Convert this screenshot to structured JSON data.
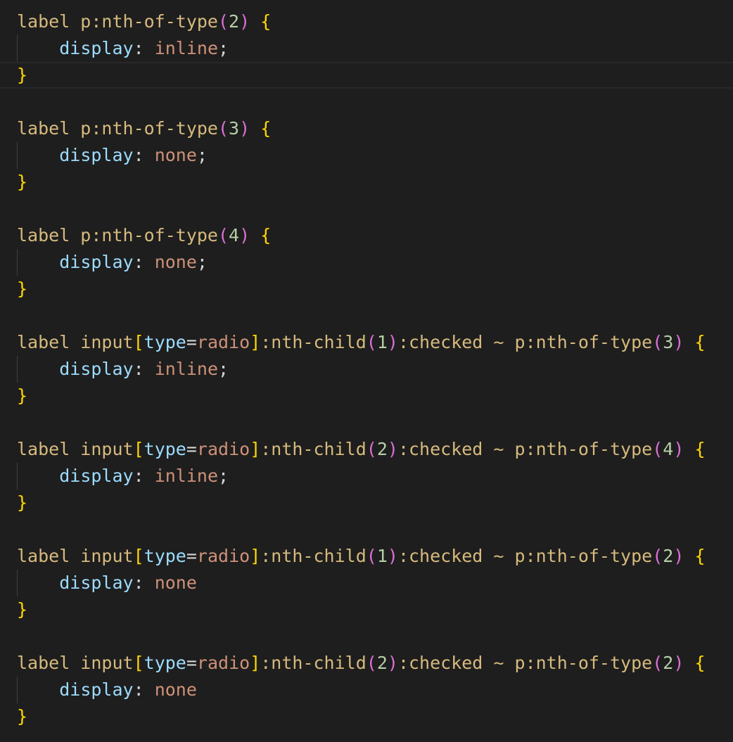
{
  "editor": {
    "language": "css",
    "theme": {
      "background": "#1e1e1e",
      "selector": "#d7ba7d",
      "brace": "#ffd700",
      "bracket": "#da70d6",
      "property": "#9cdcfe",
      "value": "#ce9178",
      "number": "#b5cea8",
      "punctuation": "#d4d4d4"
    },
    "current_line": 3,
    "lines": [
      [
        {
          "t": "label p:nth-of-type",
          "c": "t-sel"
        },
        {
          "t": "(",
          "c": "t-brk"
        },
        {
          "t": "2",
          "c": "t-num"
        },
        {
          "t": ")",
          "c": "t-brk"
        },
        {
          "t": " ",
          "c": "t-punct"
        },
        {
          "t": "{",
          "c": "t-brace"
        }
      ],
      [
        {
          "t": "    ",
          "c": "t-punct"
        },
        {
          "t": "display",
          "c": "t-prop"
        },
        {
          "t": ": ",
          "c": "t-punct"
        },
        {
          "t": "inline",
          "c": "t-val"
        },
        {
          "t": ";",
          "c": "t-punct"
        }
      ],
      [
        {
          "t": "}",
          "c": "t-brace"
        }
      ],
      [],
      [
        {
          "t": "label p:nth-of-type",
          "c": "t-sel"
        },
        {
          "t": "(",
          "c": "t-brk"
        },
        {
          "t": "3",
          "c": "t-num"
        },
        {
          "t": ")",
          "c": "t-brk"
        },
        {
          "t": " ",
          "c": "t-punct"
        },
        {
          "t": "{",
          "c": "t-brace"
        }
      ],
      [
        {
          "t": "    ",
          "c": "t-punct"
        },
        {
          "t": "display",
          "c": "t-prop"
        },
        {
          "t": ": ",
          "c": "t-punct"
        },
        {
          "t": "none",
          "c": "t-val"
        },
        {
          "t": ";",
          "c": "t-punct"
        }
      ],
      [
        {
          "t": "}",
          "c": "t-brace"
        }
      ],
      [],
      [
        {
          "t": "label p:nth-of-type",
          "c": "t-sel"
        },
        {
          "t": "(",
          "c": "t-brk"
        },
        {
          "t": "4",
          "c": "t-num"
        },
        {
          "t": ")",
          "c": "t-brk"
        },
        {
          "t": " ",
          "c": "t-punct"
        },
        {
          "t": "{",
          "c": "t-brace"
        }
      ],
      [
        {
          "t": "    ",
          "c": "t-punct"
        },
        {
          "t": "display",
          "c": "t-prop"
        },
        {
          "t": ": ",
          "c": "t-punct"
        },
        {
          "t": "none",
          "c": "t-val"
        },
        {
          "t": ";",
          "c": "t-punct"
        }
      ],
      [
        {
          "t": "}",
          "c": "t-brace"
        }
      ],
      [],
      [
        {
          "t": "label input",
          "c": "t-sel"
        },
        {
          "t": "[",
          "c": "t-brace"
        },
        {
          "t": "type",
          "c": "t-prop"
        },
        {
          "t": "=",
          "c": "t-punct"
        },
        {
          "t": "radio",
          "c": "t-val"
        },
        {
          "t": "]",
          "c": "t-brace"
        },
        {
          "t": ":nth-child",
          "c": "t-sel"
        },
        {
          "t": "(",
          "c": "t-brk"
        },
        {
          "t": "1",
          "c": "t-num"
        },
        {
          "t": ")",
          "c": "t-brk"
        },
        {
          "t": ":checked ~ p:nth-of-type",
          "c": "t-sel"
        },
        {
          "t": "(",
          "c": "t-brk"
        },
        {
          "t": "3",
          "c": "t-num"
        },
        {
          "t": ")",
          "c": "t-brk"
        },
        {
          "t": " ",
          "c": "t-punct"
        },
        {
          "t": "{",
          "c": "t-brace"
        }
      ],
      [
        {
          "t": "    ",
          "c": "t-punct"
        },
        {
          "t": "display",
          "c": "t-prop"
        },
        {
          "t": ": ",
          "c": "t-punct"
        },
        {
          "t": "inline",
          "c": "t-val"
        },
        {
          "t": ";",
          "c": "t-punct"
        }
      ],
      [
        {
          "t": "}",
          "c": "t-brace"
        }
      ],
      [],
      [
        {
          "t": "label input",
          "c": "t-sel"
        },
        {
          "t": "[",
          "c": "t-brace"
        },
        {
          "t": "type",
          "c": "t-prop"
        },
        {
          "t": "=",
          "c": "t-punct"
        },
        {
          "t": "radio",
          "c": "t-val"
        },
        {
          "t": "]",
          "c": "t-brace"
        },
        {
          "t": ":nth-child",
          "c": "t-sel"
        },
        {
          "t": "(",
          "c": "t-brk"
        },
        {
          "t": "2",
          "c": "t-num"
        },
        {
          "t": ")",
          "c": "t-brk"
        },
        {
          "t": ":checked ~ p:nth-of-type",
          "c": "t-sel"
        },
        {
          "t": "(",
          "c": "t-brk"
        },
        {
          "t": "4",
          "c": "t-num"
        },
        {
          "t": ")",
          "c": "t-brk"
        },
        {
          "t": " ",
          "c": "t-punct"
        },
        {
          "t": "{",
          "c": "t-brace"
        }
      ],
      [
        {
          "t": "    ",
          "c": "t-punct"
        },
        {
          "t": "display",
          "c": "t-prop"
        },
        {
          "t": ": ",
          "c": "t-punct"
        },
        {
          "t": "inline",
          "c": "t-val"
        },
        {
          "t": ";",
          "c": "t-punct"
        }
      ],
      [
        {
          "t": "}",
          "c": "t-brace"
        }
      ],
      [],
      [
        {
          "t": "label input",
          "c": "t-sel"
        },
        {
          "t": "[",
          "c": "t-brace"
        },
        {
          "t": "type",
          "c": "t-prop"
        },
        {
          "t": "=",
          "c": "t-punct"
        },
        {
          "t": "radio",
          "c": "t-val"
        },
        {
          "t": "]",
          "c": "t-brace"
        },
        {
          "t": ":nth-child",
          "c": "t-sel"
        },
        {
          "t": "(",
          "c": "t-brk"
        },
        {
          "t": "1",
          "c": "t-num"
        },
        {
          "t": ")",
          "c": "t-brk"
        },
        {
          "t": ":checked ~ p:nth-of-type",
          "c": "t-sel"
        },
        {
          "t": "(",
          "c": "t-brk"
        },
        {
          "t": "2",
          "c": "t-num"
        },
        {
          "t": ")",
          "c": "t-brk"
        },
        {
          "t": " ",
          "c": "t-punct"
        },
        {
          "t": "{",
          "c": "t-brace"
        }
      ],
      [
        {
          "t": "    ",
          "c": "t-punct"
        },
        {
          "t": "display",
          "c": "t-prop"
        },
        {
          "t": ": ",
          "c": "t-punct"
        },
        {
          "t": "none",
          "c": "t-val"
        }
      ],
      [
        {
          "t": "}",
          "c": "t-brace"
        }
      ],
      [],
      [
        {
          "t": "label input",
          "c": "t-sel"
        },
        {
          "t": "[",
          "c": "t-brace"
        },
        {
          "t": "type",
          "c": "t-prop"
        },
        {
          "t": "=",
          "c": "t-punct"
        },
        {
          "t": "radio",
          "c": "t-val"
        },
        {
          "t": "]",
          "c": "t-brace"
        },
        {
          "t": ":nth-child",
          "c": "t-sel"
        },
        {
          "t": "(",
          "c": "t-brk"
        },
        {
          "t": "2",
          "c": "t-num"
        },
        {
          "t": ")",
          "c": "t-brk"
        },
        {
          "t": ":checked ~ p:nth-of-type",
          "c": "t-sel"
        },
        {
          "t": "(",
          "c": "t-brk"
        },
        {
          "t": "2",
          "c": "t-num"
        },
        {
          "t": ")",
          "c": "t-brk"
        },
        {
          "t": " ",
          "c": "t-punct"
        },
        {
          "t": "{",
          "c": "t-brace"
        }
      ],
      [
        {
          "t": "    ",
          "c": "t-punct"
        },
        {
          "t": "display",
          "c": "t-prop"
        },
        {
          "t": ": ",
          "c": "t-punct"
        },
        {
          "t": "none",
          "c": "t-val"
        }
      ],
      [
        {
          "t": "}",
          "c": "t-brace"
        }
      ]
    ]
  }
}
